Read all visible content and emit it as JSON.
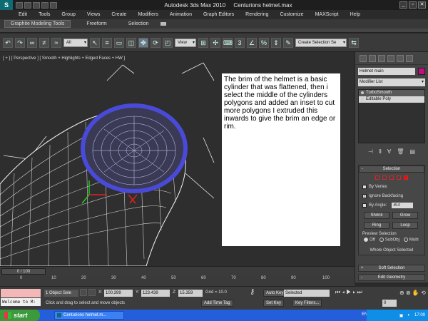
{
  "window": {
    "app": "Autodesk 3ds Max  2010",
    "file": "Centurions helmet.max",
    "minimize": "_",
    "restore": "▫",
    "close": "✕"
  },
  "menu": [
    "Edit",
    "Tools",
    "Group",
    "Views",
    "Create",
    "Modifiers",
    "Animation",
    "Graph Editors",
    "Rendering",
    "Customize",
    "MAXScript",
    "Help"
  ],
  "ribbon": {
    "tabs": [
      "Graphite Modeling Tools",
      "Freeform",
      "Selection"
    ]
  },
  "toolbar": {
    "filter": "All",
    "coord": "View",
    "selection_set": "Create Selection Se"
  },
  "viewport": {
    "label": "[ + ] [ Perspective ] [ Smooth + Highlights + Edged Faces + HW ]",
    "note": "The brim of the helmet is a basic cylinder that was flattened, then i select the middle of the cylinders polygons and added an inset to cut more polygons I extruded this inwards to give the brim an edge or rim."
  },
  "command_panel": {
    "object_name": "Helmet main",
    "object_color": "#c40c83",
    "modifier_list": "Modifier List",
    "stack": [
      "TurboSmooth",
      "Editable Poly"
    ],
    "selection": {
      "title": "Selection",
      "by_vertex": "By Vertex",
      "ignore_backfacing": "Ignore Backfacing",
      "by_angle": "By Angle:",
      "angle_value": "45.0",
      "shrink": "Shrink",
      "grow": "Grow",
      "ring": "Ring",
      "loop": "Loop",
      "preview_label": "Preview Selection",
      "preview_options": [
        "Off",
        "SubObj",
        "Multi"
      ],
      "whole_object": "Whole Object Selected"
    },
    "soft_selection": "Soft Selection",
    "edit_geometry": "Edit Geometry"
  },
  "timeline": {
    "frame": "0 / 100",
    "ticks": [
      "10",
      "20",
      "30",
      "40",
      "50",
      "60",
      "70",
      "80",
      "90",
      "100"
    ]
  },
  "status": {
    "listener": "Welcome to M:",
    "selected": "1 Object Sele",
    "prompt": "Click and drag to select and move objects",
    "x_label": "X:",
    "x": "100.399",
    "y_label": "Y:",
    "y": "123.439",
    "z_label": "Z:",
    "z": "15.359",
    "grid": "Grid = 10.0",
    "add_time_tag": "Add Time Tag",
    "auto_key": "Auto Key",
    "auto_key_mode": "Selected",
    "set_key": "Set Key",
    "key_filters": "Key Filters...",
    "frame_field": "0"
  },
  "taskbar": {
    "start": "start",
    "task": "Centurions helmet.m...",
    "lang": "EN",
    "clock": "17:09"
  }
}
